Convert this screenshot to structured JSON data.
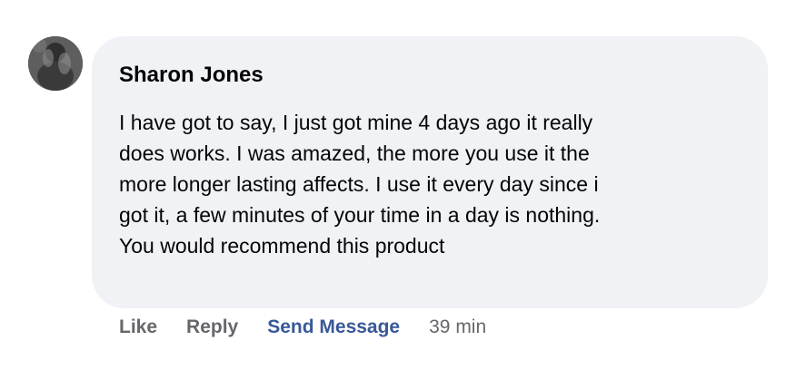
{
  "comment": {
    "author": "Sharon Jones",
    "avatar_icon": "user-avatar-photo",
    "text": "I have got to say, I just got mine 4 days ago it really\ndoes works. I was amazed, the more you use it the\nmore longer lasting affects. I use it every day since i\ngot it, a few minutes of your time in a day is nothing.\nYou would recommend this product"
  },
  "actions": {
    "like_label": "Like",
    "reply_label": "Reply",
    "send_message_label": "Send Message",
    "timestamp": "39 min"
  },
  "colors": {
    "bubble_bg": "#f0f2f5",
    "action_gray": "#65676b",
    "link_blue": "#385898"
  }
}
